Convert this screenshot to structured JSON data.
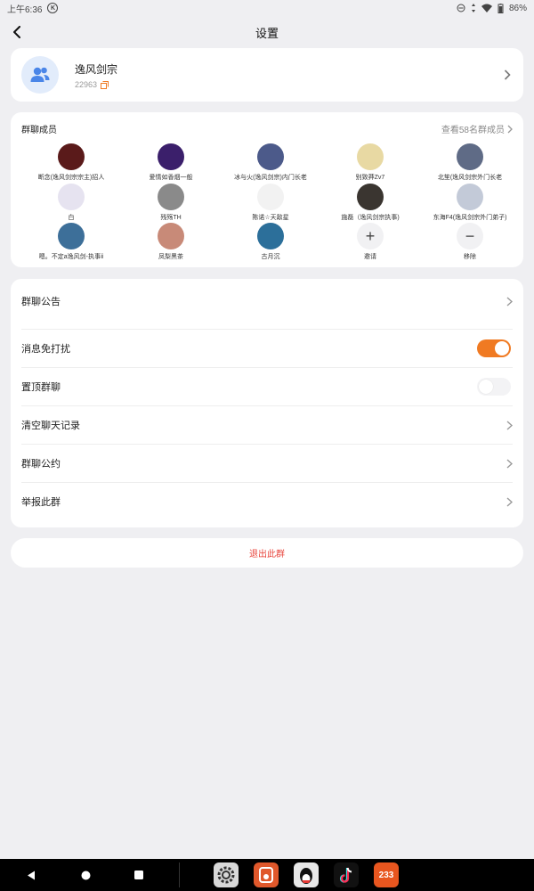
{
  "status": {
    "time": "上午6:36",
    "k_badge": "K",
    "battery": "86%"
  },
  "header": {
    "title": "设置",
    "back_icon": "chevron-left-icon"
  },
  "group": {
    "name": "逸风剑宗",
    "id": "22963",
    "avatar_icon": "group-icon",
    "copy_icon": "copy-icon"
  },
  "members": {
    "label": "群聊成员",
    "view_all": "查看58名群成员",
    "list": [
      {
        "name": "断念(逸风剑宗宗主)招人",
        "color": "#5a1a1a"
      },
      {
        "name": "爱情如香烟一般",
        "color": "#3b1f6b"
      },
      {
        "name": "冰与火(逸风剑宗)内门长老",
        "color": "#4c5a8a"
      },
      {
        "name": "别致莽Zv7",
        "color": "#e8d9a3"
      },
      {
        "name": "北笙(逸风剑宗外门长老",
        "color": "#5f6b86"
      },
      {
        "name": "白",
        "color": "#e6e3f0"
      },
      {
        "name": "残殇TH",
        "color": "#8a8a8a"
      },
      {
        "name": "陈诺☆天敌星",
        "color": "#f2f2f2"
      },
      {
        "name": "施磊（逸风剑宗执事)",
        "color": "#3a3530"
      },
      {
        "name": "东海F4(逸风剑宗外门弟子)",
        "color": "#c3cad8"
      },
      {
        "name": "嗯。不定a逸风剑-执事ⅱ",
        "color": "#3d6f99"
      },
      {
        "name": "凤梨黑茶",
        "color": "#c88a78"
      },
      {
        "name": "古月沉",
        "color": "#2c6f9a"
      }
    ],
    "invite_label": "邀请",
    "remove_label": "移除"
  },
  "settings": {
    "announcement": "群聊公告",
    "mute": "消息免打扰",
    "mute_on": true,
    "pin": "置顶群聊",
    "pin_on": false,
    "clear": "清空聊天记录",
    "rules": "群聊公约",
    "report": "举报此群"
  },
  "exit_label": "退出此群",
  "colors": {
    "accent": "#f07a22",
    "danger": "#e8453c",
    "background": "#efeff2"
  },
  "dock": {
    "apps": [
      "settings-app-icon",
      "photo-app-icon",
      "qq-app-icon",
      "tiktok-app-icon",
      "233-app-icon"
    ],
    "app_233_label": "233"
  }
}
